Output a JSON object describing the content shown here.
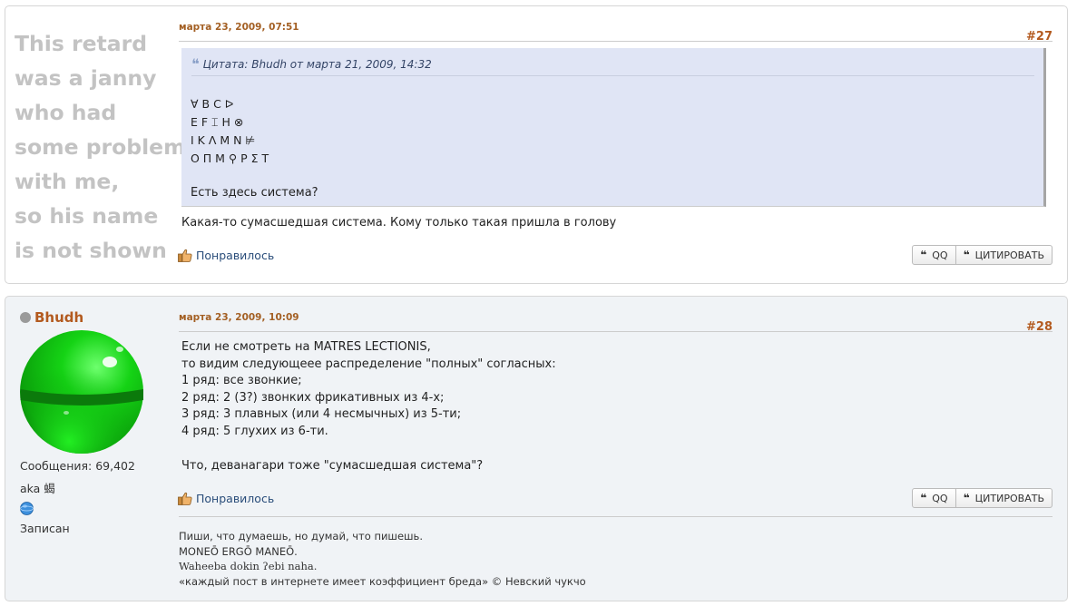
{
  "post27": {
    "poster_note_lines": [
      "This retard",
      "was a janny",
      "who had",
      "some problem",
      "with me,",
      "so his name",
      "is not shown"
    ],
    "date": "марта 23, 2009, 07:51",
    "number": "#27",
    "quote": {
      "header": "Цитата: Bhudh от марта 21, 2009, 14:32",
      "lines": [
        "∀ B C ᐅ",
        "E F ⌶ H ⊗",
        "I K Λ M N ⊭",
        "O Π M ⚲ P Σ T"
      ],
      "last": "Есть здесь система?"
    },
    "text": "Какая-то сумасшедшая система. Кому только такая пришла в голову",
    "like_label": "Понравилось",
    "qq_label": "QQ",
    "quote_label": "ЦИТИРОВАТЬ"
  },
  "post28": {
    "username": "Bhudh",
    "date": "марта 23, 2009, 10:09",
    "number": "#28",
    "lines": [
      "Если не смотреть на MATRES LECTIONIS,",
      "то видим следующееe распределение \"полных\" согласных:",
      "1 ряд: все звонкие;",
      "2 ряд: 2 (3?) звонких фрикативных из 4-х;",
      "3 ряд: 3 плавных (или 4 несмычных) из 5-ти;",
      "4 ряд: 5 глухих из 6-ти."
    ],
    "last": "Что, деванагари тоже \"сумасшедшая система\"?",
    "messages_label": "Сообщения: 69,402",
    "aka": "aka 蝎",
    "registered": "Записан",
    "like_label": "Понравилось",
    "qq_label": "QQ",
    "quote_label": "ЦИТИРОВАТЬ",
    "signature": [
      "Пиши, что думаешь, но думай, что пишешь.",
      "MONEŌ ERGŌ MANEŌ.",
      "Waheeba dokin ʔebi naha.",
      "«каждый пост в интернете имеет коэффициент бреда» © Невский чукчо"
    ]
  },
  "colors": {
    "accent": "#b35a1f",
    "quote_bg": "#e0e5f5",
    "post_bg": "#f0f3f6"
  }
}
